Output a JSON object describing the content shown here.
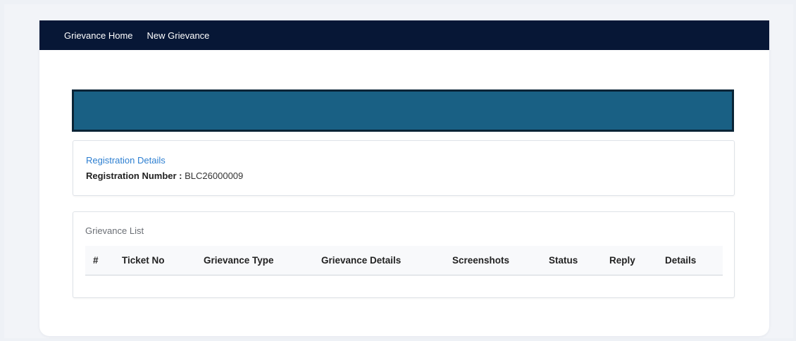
{
  "nav": {
    "items": [
      "Grievance Home",
      "New Grievance"
    ]
  },
  "registration": {
    "title": "Registration Details",
    "number_label": "Registration Number :",
    "number_value": "BLC26000009"
  },
  "grievance_list": {
    "title": "Grievance List",
    "columns": [
      "#",
      "Ticket No",
      "Grievance Type",
      "Grievance Details",
      "Screenshots",
      "Status",
      "Reply",
      "Details"
    ],
    "rows": []
  },
  "colors": {
    "navbar": "#071736",
    "banner": "#196084",
    "link": "#2d7fd1"
  }
}
